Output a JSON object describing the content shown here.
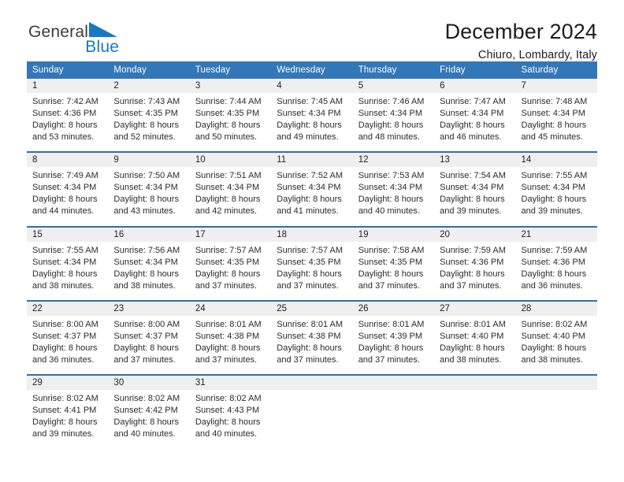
{
  "brand": {
    "name_line1": "General",
    "name_line2": "Blue",
    "logo_icon": "blue-triangle-icon",
    "accent_color": "#1878c4"
  },
  "header": {
    "title": "December 2024",
    "subtitle": "Chiuro, Lombardy, Italy"
  },
  "theme": {
    "header_bar_color": "#3277b8",
    "daynum_band_color": "#efefef",
    "week_divider_color": "#2f6fae"
  },
  "weekday_headers": [
    "Sunday",
    "Monday",
    "Tuesday",
    "Wednesday",
    "Thursday",
    "Friday",
    "Saturday"
  ],
  "weeks": [
    {
      "days": [
        {
          "num": "1",
          "sunrise": "Sunrise: 7:42 AM",
          "sunset": "Sunset: 4:36 PM",
          "daylight1": "Daylight: 8 hours",
          "daylight2": "and 53 minutes."
        },
        {
          "num": "2",
          "sunrise": "Sunrise: 7:43 AM",
          "sunset": "Sunset: 4:35 PM",
          "daylight1": "Daylight: 8 hours",
          "daylight2": "and 52 minutes."
        },
        {
          "num": "3",
          "sunrise": "Sunrise: 7:44 AM",
          "sunset": "Sunset: 4:35 PM",
          "daylight1": "Daylight: 8 hours",
          "daylight2": "and 50 minutes."
        },
        {
          "num": "4",
          "sunrise": "Sunrise: 7:45 AM",
          "sunset": "Sunset: 4:34 PM",
          "daylight1": "Daylight: 8 hours",
          "daylight2": "and 49 minutes."
        },
        {
          "num": "5",
          "sunrise": "Sunrise: 7:46 AM",
          "sunset": "Sunset: 4:34 PM",
          "daylight1": "Daylight: 8 hours",
          "daylight2": "and 48 minutes."
        },
        {
          "num": "6",
          "sunrise": "Sunrise: 7:47 AM",
          "sunset": "Sunset: 4:34 PM",
          "daylight1": "Daylight: 8 hours",
          "daylight2": "and 46 minutes."
        },
        {
          "num": "7",
          "sunrise": "Sunrise: 7:48 AM",
          "sunset": "Sunset: 4:34 PM",
          "daylight1": "Daylight: 8 hours",
          "daylight2": "and 45 minutes."
        }
      ]
    },
    {
      "days": [
        {
          "num": "8",
          "sunrise": "Sunrise: 7:49 AM",
          "sunset": "Sunset: 4:34 PM",
          "daylight1": "Daylight: 8 hours",
          "daylight2": "and 44 minutes."
        },
        {
          "num": "9",
          "sunrise": "Sunrise: 7:50 AM",
          "sunset": "Sunset: 4:34 PM",
          "daylight1": "Daylight: 8 hours",
          "daylight2": "and 43 minutes."
        },
        {
          "num": "10",
          "sunrise": "Sunrise: 7:51 AM",
          "sunset": "Sunset: 4:34 PM",
          "daylight1": "Daylight: 8 hours",
          "daylight2": "and 42 minutes."
        },
        {
          "num": "11",
          "sunrise": "Sunrise: 7:52 AM",
          "sunset": "Sunset: 4:34 PM",
          "daylight1": "Daylight: 8 hours",
          "daylight2": "and 41 minutes."
        },
        {
          "num": "12",
          "sunrise": "Sunrise: 7:53 AM",
          "sunset": "Sunset: 4:34 PM",
          "daylight1": "Daylight: 8 hours",
          "daylight2": "and 40 minutes."
        },
        {
          "num": "13",
          "sunrise": "Sunrise: 7:54 AM",
          "sunset": "Sunset: 4:34 PM",
          "daylight1": "Daylight: 8 hours",
          "daylight2": "and 39 minutes."
        },
        {
          "num": "14",
          "sunrise": "Sunrise: 7:55 AM",
          "sunset": "Sunset: 4:34 PM",
          "daylight1": "Daylight: 8 hours",
          "daylight2": "and 39 minutes."
        }
      ]
    },
    {
      "days": [
        {
          "num": "15",
          "sunrise": "Sunrise: 7:55 AM",
          "sunset": "Sunset: 4:34 PM",
          "daylight1": "Daylight: 8 hours",
          "daylight2": "and 38 minutes."
        },
        {
          "num": "16",
          "sunrise": "Sunrise: 7:56 AM",
          "sunset": "Sunset: 4:34 PM",
          "daylight1": "Daylight: 8 hours",
          "daylight2": "and 38 minutes."
        },
        {
          "num": "17",
          "sunrise": "Sunrise: 7:57 AM",
          "sunset": "Sunset: 4:35 PM",
          "daylight1": "Daylight: 8 hours",
          "daylight2": "and 37 minutes."
        },
        {
          "num": "18",
          "sunrise": "Sunrise: 7:57 AM",
          "sunset": "Sunset: 4:35 PM",
          "daylight1": "Daylight: 8 hours",
          "daylight2": "and 37 minutes."
        },
        {
          "num": "19",
          "sunrise": "Sunrise: 7:58 AM",
          "sunset": "Sunset: 4:35 PM",
          "daylight1": "Daylight: 8 hours",
          "daylight2": "and 37 minutes."
        },
        {
          "num": "20",
          "sunrise": "Sunrise: 7:59 AM",
          "sunset": "Sunset: 4:36 PM",
          "daylight1": "Daylight: 8 hours",
          "daylight2": "and 37 minutes."
        },
        {
          "num": "21",
          "sunrise": "Sunrise: 7:59 AM",
          "sunset": "Sunset: 4:36 PM",
          "daylight1": "Daylight: 8 hours",
          "daylight2": "and 36 minutes."
        }
      ]
    },
    {
      "days": [
        {
          "num": "22",
          "sunrise": "Sunrise: 8:00 AM",
          "sunset": "Sunset: 4:37 PM",
          "daylight1": "Daylight: 8 hours",
          "daylight2": "and 36 minutes."
        },
        {
          "num": "23",
          "sunrise": "Sunrise: 8:00 AM",
          "sunset": "Sunset: 4:37 PM",
          "daylight1": "Daylight: 8 hours",
          "daylight2": "and 37 minutes."
        },
        {
          "num": "24",
          "sunrise": "Sunrise: 8:01 AM",
          "sunset": "Sunset: 4:38 PM",
          "daylight1": "Daylight: 8 hours",
          "daylight2": "and 37 minutes."
        },
        {
          "num": "25",
          "sunrise": "Sunrise: 8:01 AM",
          "sunset": "Sunset: 4:38 PM",
          "daylight1": "Daylight: 8 hours",
          "daylight2": "and 37 minutes."
        },
        {
          "num": "26",
          "sunrise": "Sunrise: 8:01 AM",
          "sunset": "Sunset: 4:39 PM",
          "daylight1": "Daylight: 8 hours",
          "daylight2": "and 37 minutes."
        },
        {
          "num": "27",
          "sunrise": "Sunrise: 8:01 AM",
          "sunset": "Sunset: 4:40 PM",
          "daylight1": "Daylight: 8 hours",
          "daylight2": "and 38 minutes."
        },
        {
          "num": "28",
          "sunrise": "Sunrise: 8:02 AM",
          "sunset": "Sunset: 4:40 PM",
          "daylight1": "Daylight: 8 hours",
          "daylight2": "and 38 minutes."
        }
      ]
    },
    {
      "days": [
        {
          "num": "29",
          "sunrise": "Sunrise: 8:02 AM",
          "sunset": "Sunset: 4:41 PM",
          "daylight1": "Daylight: 8 hours",
          "daylight2": "and 39 minutes."
        },
        {
          "num": "30",
          "sunrise": "Sunrise: 8:02 AM",
          "sunset": "Sunset: 4:42 PM",
          "daylight1": "Daylight: 8 hours",
          "daylight2": "and 40 minutes."
        },
        {
          "num": "31",
          "sunrise": "Sunrise: 8:02 AM",
          "sunset": "Sunset: 4:43 PM",
          "daylight1": "Daylight: 8 hours",
          "daylight2": "and 40 minutes."
        },
        {
          "num": "",
          "sunrise": "",
          "sunset": "",
          "daylight1": "",
          "daylight2": ""
        },
        {
          "num": "",
          "sunrise": "",
          "sunset": "",
          "daylight1": "",
          "daylight2": ""
        },
        {
          "num": "",
          "sunrise": "",
          "sunset": "",
          "daylight1": "",
          "daylight2": ""
        },
        {
          "num": "",
          "sunrise": "",
          "sunset": "",
          "daylight1": "",
          "daylight2": ""
        }
      ]
    }
  ]
}
